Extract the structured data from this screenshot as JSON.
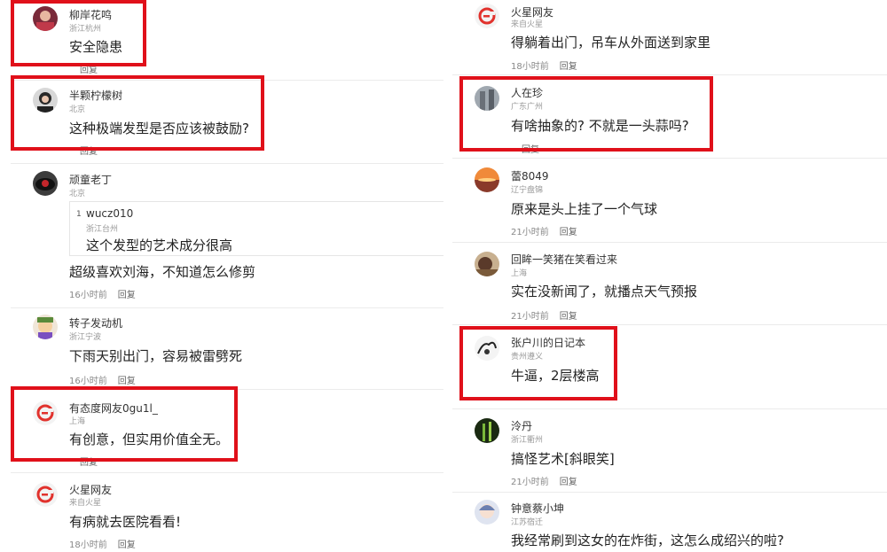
{
  "colors": {
    "highlight": "#e0101a",
    "brand_logo": "#e1322d"
  },
  "left": [
    {
      "id": "c1",
      "name": "柳岸花鸣",
      "location": "浙江杭州",
      "text": "安全隐患",
      "time": "",
      "reply": "回复",
      "avatar": "avatar-photo-red-icon"
    },
    {
      "id": "c2",
      "name": "半颗柠檬树",
      "location": "北京",
      "text": "这种极端发型是否应该被鼓励?",
      "time": "",
      "reply": "回复",
      "avatar": "avatar-photo-woman-icon"
    },
    {
      "id": "c3",
      "name": "顽童老丁",
      "location": "北京",
      "text": "超级喜欢刘海，不知道怎么修剪",
      "time": "16小时前",
      "reply": "回复",
      "avatar": "avatar-photo-car-icon",
      "quote": {
        "num": "1",
        "name": "wucz010",
        "location": "浙江台州",
        "text": "这个发型的艺术成分很高"
      }
    },
    {
      "id": "c4",
      "name": "转子发动机",
      "location": "浙江宁波",
      "text": "下雨天别出门，容易被雷劈死",
      "time": "16小时前",
      "reply": "回复",
      "avatar": "avatar-cartoon-icon"
    },
    {
      "id": "c5",
      "name": "有态度网友0gu1l_",
      "location": "上海",
      "text": "有创意，但实用价值全无。",
      "time": "",
      "reply": "回复",
      "avatar": "netease-logo-icon"
    },
    {
      "id": "c6",
      "name": "火星网友",
      "location": "来自火星",
      "text": "有病就去医院看看!",
      "time": "18小时前",
      "reply": "回复",
      "avatar": "netease-logo-icon"
    }
  ],
  "right": [
    {
      "id": "r1",
      "name": "火星网友",
      "location": "来自火星",
      "text": "得躺着出门，吊车从外面送到家里",
      "time": "18小时前",
      "reply": "回复",
      "avatar": "netease-logo-icon"
    },
    {
      "id": "r2",
      "name": "人在珍",
      "location": "广东广州",
      "text": "有啥抽象的? 不就是一头蒜吗?",
      "time": "",
      "reply": "回复",
      "avatar": "avatar-photo-building-icon"
    },
    {
      "id": "r3",
      "name": "蕾8049",
      "location": "辽宁盘锦",
      "text": "原来是头上挂了一个气球",
      "time": "21小时前",
      "reply": "回复",
      "avatar": "avatar-photo-sunset-icon"
    },
    {
      "id": "r4",
      "name": "回眸一笑猪在笑看过来",
      "location": "上海",
      "text": "实在没新闻了，就播点天气预报",
      "time": "21小时前",
      "reply": "回复",
      "avatar": "avatar-photo-landscape-icon"
    },
    {
      "id": "r5",
      "name": "张户川的日记本",
      "location": "贵州遵义",
      "text": "牛逼，2层楼高",
      "time": "",
      "reply": "",
      "avatar": "avatar-sketch-icon"
    },
    {
      "id": "r6",
      "name": "泠丹",
      "location": "浙江衢州",
      "text": "搞怪艺术[斜眼笑]",
      "time": "21小时前",
      "reply": "回复",
      "avatar": "avatar-photo-green-icon"
    },
    {
      "id": "r7",
      "name": "钟意蔡小坤",
      "location": "江苏宿迁",
      "text": "我经常刷到这女的在炸街，这怎么成绍兴的啦?",
      "time": "",
      "reply": "",
      "avatar": "avatar-anime-icon"
    }
  ]
}
